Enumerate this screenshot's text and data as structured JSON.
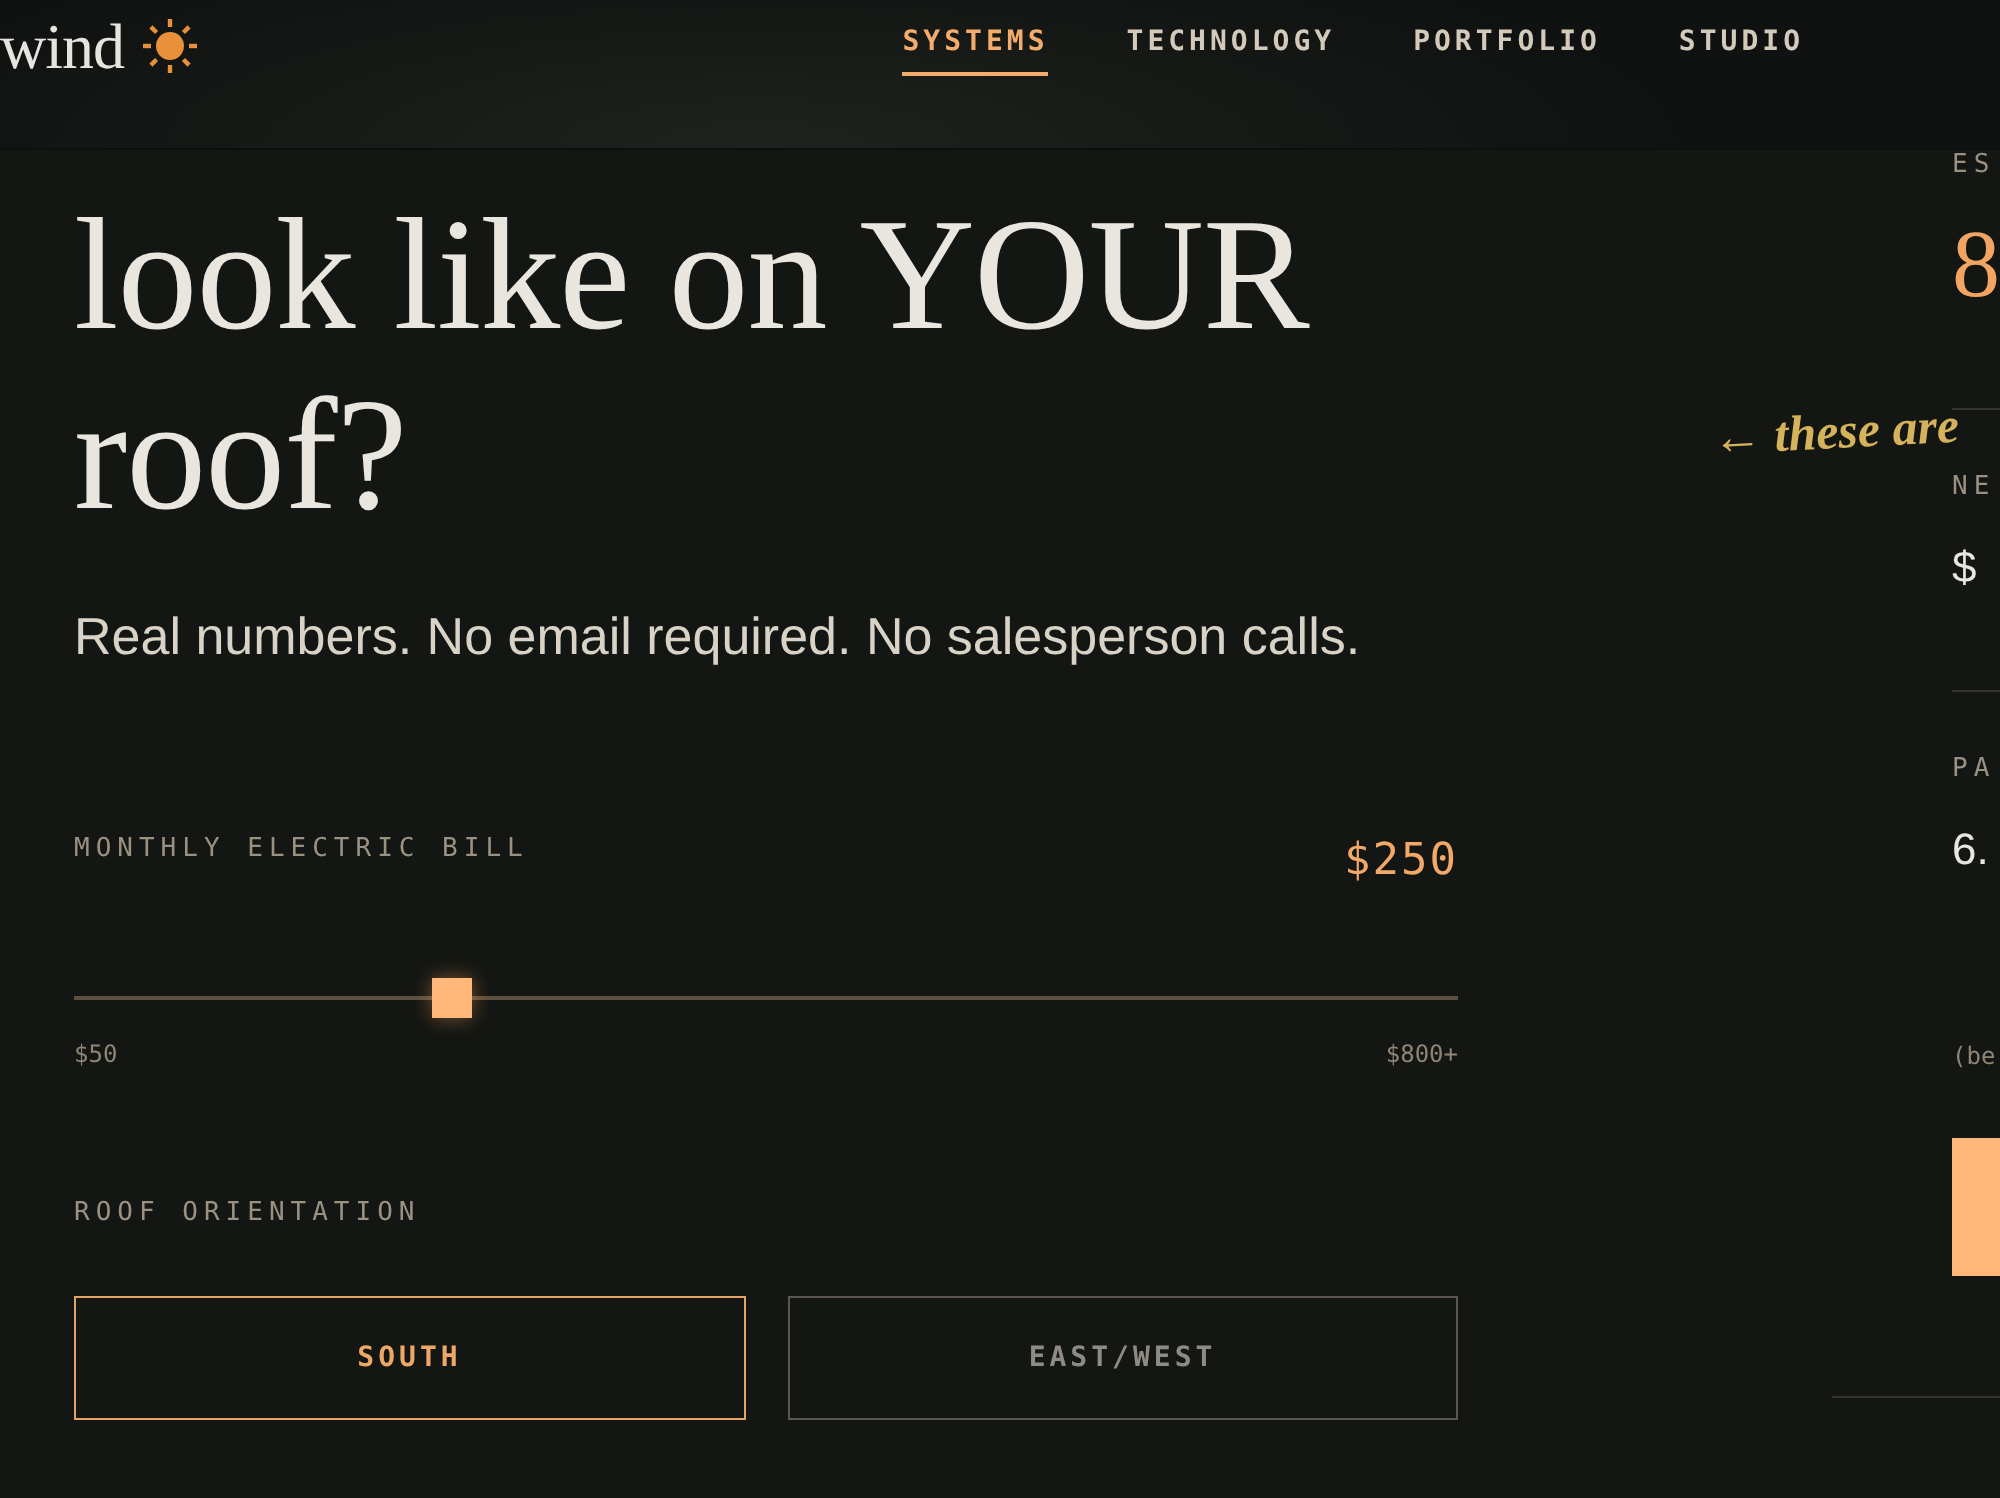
{
  "header": {
    "logo": "wind",
    "nav": [
      {
        "label": "SYSTEMS",
        "selected": true
      },
      {
        "label": "TECHNOLOGY",
        "selected": false
      },
      {
        "label": "PORTFOLIO",
        "selected": false
      },
      {
        "label": "STUDIO",
        "selected": false
      }
    ]
  },
  "hero": {
    "heading": "look like on YOUR roof?",
    "subtitle": "Real numbers. No email required. No salesperson calls."
  },
  "calculator": {
    "bill": {
      "label": "MONTHLY ELECTRIC BILL",
      "value": "$250",
      "level": 0.273,
      "min": "$50",
      "max": "$800+"
    },
    "orientation": {
      "label": "ROOF ORIENTATION",
      "options": [
        {
          "label": "SOUTH",
          "selected": true
        },
        {
          "label": "EAST/WEST",
          "selected": false
        }
      ]
    }
  },
  "annotation": "← these are",
  "results": {
    "items": [
      {
        "label": "ES",
        "value": "8",
        "kind": "highlight"
      },
      {
        "label": "NE",
        "value": "$",
        "kind": "plain"
      },
      {
        "label": "PA",
        "value": "6.",
        "kind": "plain"
      }
    ],
    "note": "(be"
  }
}
